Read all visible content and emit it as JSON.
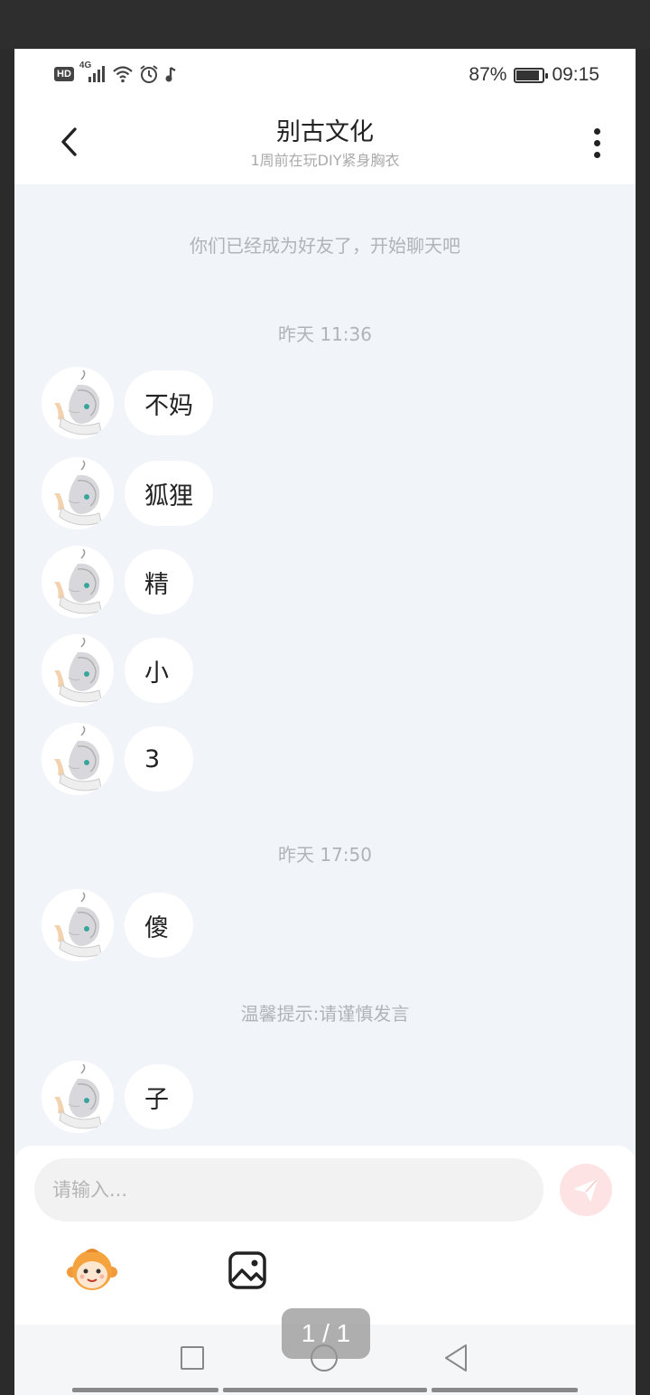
{
  "status_bar": {
    "hd_label": "HD",
    "network_label": "4G",
    "battery_percent": "87%",
    "battery_level": 0.87,
    "time": "09:15"
  },
  "header": {
    "title": "别古文化",
    "subtitle": "1周前在玩DIY紧身胸衣",
    "back_icon": "chevron-left-icon",
    "more_icon": "more-vertical-icon"
  },
  "chat": {
    "friend_notice": "你们已经成为好友了，开始聊天吧",
    "groups": [
      {
        "timestamp": "昨天 11:36",
        "messages": [
          "不妈",
          "狐狸",
          "精",
          "小",
          "3"
        ]
      },
      {
        "timestamp": "昨天 17:50",
        "messages": [
          "傻"
        ]
      }
    ],
    "warning": "温馨提示:请谨慎发言",
    "last_message": "子"
  },
  "composer": {
    "placeholder": "请输入...",
    "send_icon": "send-icon",
    "emoji_icon": "monkey-emoji-icon",
    "image_icon": "image-icon",
    "send_color": "#f08a8a"
  },
  "navigation": {
    "recent_icon": "square-icon",
    "home_icon": "circle-icon",
    "back_icon": "triangle-back-icon"
  },
  "viewer": {
    "page_indicator": "1 / 1"
  }
}
